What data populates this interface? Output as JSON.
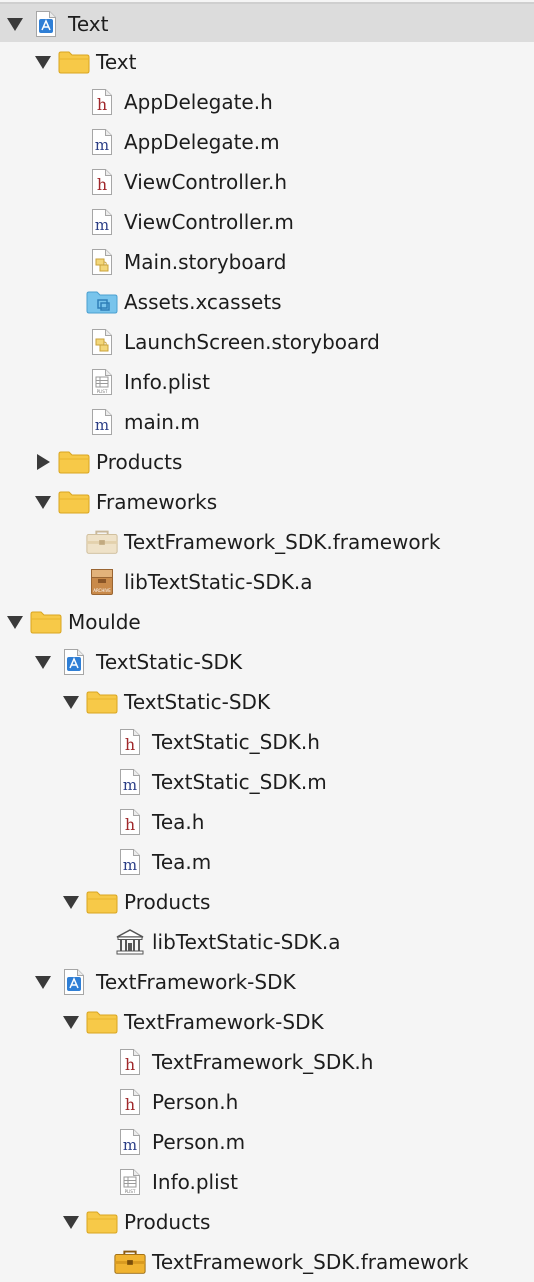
{
  "tree": {
    "rows": [
      {
        "label": "Text",
        "icon": "xcode-project-icon",
        "depth": 0,
        "disclosure": "expanded",
        "selected": true
      },
      {
        "label": "Text",
        "icon": "folder-icon",
        "depth": 1,
        "disclosure": "expanded"
      },
      {
        "label": "AppDelegate.h",
        "icon": "header-file-icon",
        "depth": 2,
        "disclosure": "none"
      },
      {
        "label": "AppDelegate.m",
        "icon": "objc-file-icon",
        "depth": 2,
        "disclosure": "none"
      },
      {
        "label": "ViewController.h",
        "icon": "header-file-icon",
        "depth": 2,
        "disclosure": "none"
      },
      {
        "label": "ViewController.m",
        "icon": "objc-file-icon",
        "depth": 2,
        "disclosure": "none"
      },
      {
        "label": "Main.storyboard",
        "icon": "storyboard-file-icon",
        "depth": 2,
        "disclosure": "none"
      },
      {
        "label": "Assets.xcassets",
        "icon": "assets-folder-icon",
        "depth": 2,
        "disclosure": "none"
      },
      {
        "label": "LaunchScreen.storyboard",
        "icon": "storyboard-file-icon",
        "depth": 2,
        "disclosure": "none"
      },
      {
        "label": "Info.plist",
        "icon": "plist-file-icon",
        "depth": 2,
        "disclosure": "none"
      },
      {
        "label": "main.m",
        "icon": "objc-file-icon",
        "depth": 2,
        "disclosure": "none"
      },
      {
        "label": "Products",
        "icon": "folder-icon",
        "depth": 1,
        "disclosure": "collapsed"
      },
      {
        "label": "Frameworks",
        "icon": "folder-icon",
        "depth": 1,
        "disclosure": "expanded"
      },
      {
        "label": "TextFramework_SDK.framework",
        "icon": "framework-faded-icon",
        "depth": 2,
        "disclosure": "none"
      },
      {
        "label": "libTextStatic-SDK.a",
        "icon": "archive-icon",
        "depth": 2,
        "disclosure": "none"
      },
      {
        "label": "Moulde",
        "icon": "folder-icon",
        "depth": 0,
        "disclosure": "expanded"
      },
      {
        "label": "TextStatic-SDK",
        "icon": "xcode-project-icon",
        "depth": 1,
        "disclosure": "expanded"
      },
      {
        "label": "TextStatic-SDK",
        "icon": "folder-icon",
        "depth": 2,
        "disclosure": "expanded"
      },
      {
        "label": "TextStatic_SDK.h",
        "icon": "header-file-icon",
        "depth": 3,
        "disclosure": "none"
      },
      {
        "label": "TextStatic_SDK.m",
        "icon": "objc-file-icon",
        "depth": 3,
        "disclosure": "none"
      },
      {
        "label": "Tea.h",
        "icon": "header-file-icon",
        "depth": 3,
        "disclosure": "none"
      },
      {
        "label": "Tea.m",
        "icon": "objc-file-icon",
        "depth": 3,
        "disclosure": "none"
      },
      {
        "label": "Products",
        "icon": "folder-icon",
        "depth": 2,
        "disclosure": "expanded"
      },
      {
        "label": "libTextStatic-SDK.a",
        "icon": "library-icon",
        "depth": 3,
        "disclosure": "none"
      },
      {
        "label": "TextFramework-SDK",
        "icon": "xcode-project-icon",
        "depth": 1,
        "disclosure": "expanded"
      },
      {
        "label": "TextFramework-SDK",
        "icon": "folder-icon",
        "depth": 2,
        "disclosure": "expanded"
      },
      {
        "label": "TextFramework_SDK.h",
        "icon": "header-file-icon",
        "depth": 3,
        "disclosure": "none"
      },
      {
        "label": "Person.h",
        "icon": "header-file-icon",
        "depth": 3,
        "disclosure": "none"
      },
      {
        "label": "Person.m",
        "icon": "objc-file-icon",
        "depth": 3,
        "disclosure": "none"
      },
      {
        "label": "Info.plist",
        "icon": "plist-file-icon",
        "depth": 3,
        "disclosure": "none"
      },
      {
        "label": "Products",
        "icon": "folder-icon",
        "depth": 2,
        "disclosure": "expanded"
      },
      {
        "label": "TextFramework_SDK.framework",
        "icon": "framework-icon",
        "depth": 3,
        "disclosure": "none"
      }
    ]
  },
  "icon_glyphs": {
    "header": "h",
    "implementation": "m",
    "plist_caption": "PLIST",
    "archive_caption": "ARCHIVE"
  },
  "colors": {
    "selection": "#dcdcdc",
    "folder": "#f7c948",
    "header_letter": "#a0282b",
    "impl_letter": "#2b3e86",
    "project_blue": "#2f7fd6"
  }
}
